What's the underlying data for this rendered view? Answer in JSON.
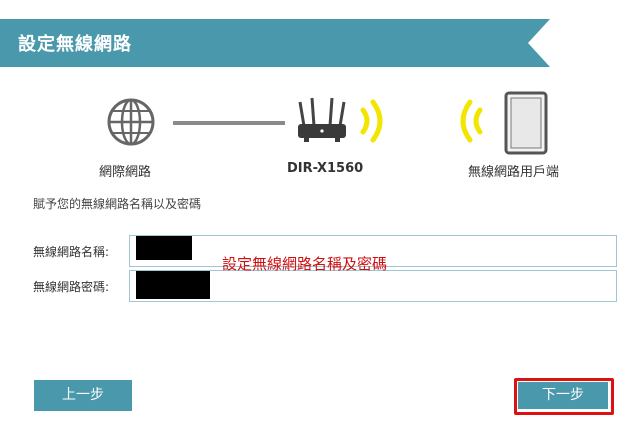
{
  "header": {
    "title": "設定無線網路"
  },
  "diagram": {
    "internet_label": "網際網路",
    "router_label": "DIR-X1560",
    "client_label": "無線網路用戶端"
  },
  "instruction": "賦予您的無線網路名稱以及密碼",
  "form": {
    "ssid_label": "無線網路名稱:",
    "password_label": "無線網路密碼:"
  },
  "annotation": "設定無線網路名稱及密碼",
  "buttons": {
    "prev": "上一步",
    "next": "下一步"
  },
  "colors": {
    "accent": "#4a98ab",
    "signal": "#f2e600",
    "highlight": "#d11111"
  }
}
